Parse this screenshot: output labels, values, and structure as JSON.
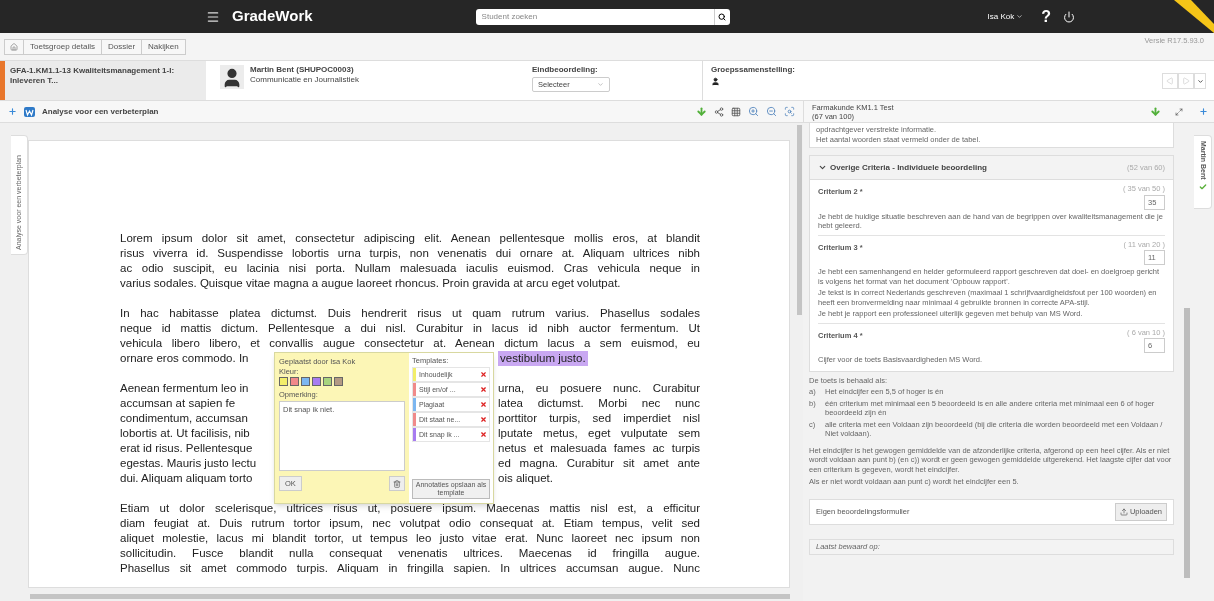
{
  "topbar": {
    "brand": "GradeWork",
    "search": {
      "placeholder": "Student zoeken"
    },
    "user": "Isa Kok",
    "help": "?"
  },
  "breadcrumbs": [
    {
      "label": "Toetsgroep details"
    },
    {
      "label": "Dossier"
    },
    {
      "label": "Nakijken"
    }
  ],
  "version": "Versie R17.5.93.0",
  "info": {
    "assignment": "GFA-1.KM1.1-13 Kwaliteitsmanagement 1-I: Inleveren T...",
    "student_name": "Martin Bent (SHUPOC0003)",
    "student_program": "Communicatie en Journalistiek",
    "final_grade_label": "Eindbeoordeling:",
    "final_grade_select": "Selecteer",
    "group_label": "Groepssamenstelling:"
  },
  "document": {
    "title": "Analyse voor een verbeterplan",
    "side_tab": "Analyse voor een verbeterplan",
    "paragraphs": [
      [
        {
          "kind": "full",
          "text": "Lorem ipsum dolor sit amet, consectetur adipiscing elit. Aenean pellentesque mollis eros, at blandit"
        },
        {
          "kind": "full",
          "text": "risus viverra id. Suspendisse lobortis urna turpis, non venenatis dui ornare at. Aliquam ultrices nibh"
        },
        {
          "kind": "full",
          "text": "ac odio suscipit, eu lacinia nisi porta. Nullam malesuada iaculis euismod. Cras vehicula neque in"
        },
        {
          "kind": "full",
          "text": "varius sodales. Quisque vitae magna a augue laoreet rhoncus. Proin gravida at arcu eget volutpat."
        }
      ],
      [
        {
          "kind": "full",
          "text": "In hac habitasse platea dictumst. Duis hendrerit risus ut quam rutrum varius. Phasellus sodales"
        },
        {
          "kind": "full",
          "text": "neque id mattis dictum. Pellentesque a dui nisl. Curabitur in lacus id nibh auctor fermentum. Ut"
        },
        {
          "kind": "full",
          "text": "vehicula libero libero, et convallis augue consectetur at. Aenean dictum lacus a sem euismod, eu"
        },
        {
          "kind": "split",
          "left": "ornare eros commodo. In",
          "right": "vestibulum justo.",
          "highlighted": true
        }
      ],
      [
        {
          "kind": "split",
          "left": "Aenean fermentum leo in",
          "right": "urna, eu posuere nunc. Curabitur",
          "highlighted": false
        },
        {
          "kind": "split",
          "left": "accumsan at sapien fe",
          "right": "latea dictumst. Morbi nec nunc",
          "highlighted": false
        },
        {
          "kind": "split",
          "left": "condimentum, accumsan",
          "right": "porttitor turpis, sed imperdiet nisl",
          "highlighted": false
        },
        {
          "kind": "split",
          "left": "lobortis at. Ut facilisis, nib",
          "right": "lputate metus, eget vulputate sem",
          "highlighted": false
        },
        {
          "kind": "split",
          "left": "erat id risus. Pellentesque",
          "right": "netus et malesuada fames ac turpis",
          "highlighted": false
        },
        {
          "kind": "split",
          "left": "egestas. Mauris justo lectu",
          "right": "ed magna. Curabitur sit amet ante",
          "highlighted": false
        },
        {
          "kind": "split",
          "left": "dui. Aliquam aliquam torto",
          "right": "ois aliquet.",
          "highlighted": false
        }
      ],
      [
        {
          "kind": "full",
          "text": "Etiam ut dolor scelerisque, ultrices risus ut, posuere ipsum. Maecenas mattis nisl est, a efficitur"
        },
        {
          "kind": "full",
          "text": "diam feugiat at. Duis rutrum tortor ipsum, nec volutpat odio consequat at. Etiam tempus, velit sed"
        },
        {
          "kind": "full",
          "text": "aliquet molestie, lacus mi blandit tortor, ut tempus leo justo vitae erat. Nunc laoreet nec ipsum non"
        },
        {
          "kind": "full",
          "text": "sollicitudin. Fusce blandit nulla consequat venenatis ultrices. Maecenas id fringilla augue."
        },
        {
          "kind": "full",
          "text": "Phasellus sit amet commodo turpis. Aliquam in fringilla sapien. In ultrices accumsan augue. Nunc"
        }
      ]
    ]
  },
  "annotation": {
    "author": "Geplaatst door Isa Kok",
    "color_label": "Kleur:",
    "colors": [
      {
        "color": "#f2ee6a"
      },
      {
        "color": "#f08a8a"
      },
      {
        "color": "#7cb6f0"
      },
      {
        "color": "#a77cf0"
      },
      {
        "color": "#a8d47e"
      },
      {
        "color": "#b39a84"
      }
    ],
    "remark_label": "Opmerking:",
    "remark": "Dit snap ik niet.",
    "ok": "OK",
    "templates_label": "Templates:",
    "templates": [
      {
        "label": "Inhoudelijk",
        "color": "#f2ee6a"
      },
      {
        "label": "Stijl en/of ...",
        "color": "#f08a8a"
      },
      {
        "label": "Plagiaat",
        "color": "#7cb6f0"
      },
      {
        "label": "Dit staat ne...",
        "color": "#f08a8a"
      },
      {
        "label": "Dit snap ik ...",
        "color": "#a77cf0"
      }
    ],
    "save_template": "Annotaties opslaan als template"
  },
  "rubric": {
    "title": "Farmakunde KM1.1 Test",
    "score": "(67 van 100)",
    "side_tab": "Martin Bent",
    "intro_lines": [
      "opdrachtgever verstrekte informatie.",
      "Het aantal woorden staat vermeld onder de tabel."
    ],
    "section": {
      "title": "Overige Criteria - Individuele beoordeling",
      "score": "(52 van 60)",
      "expanded": true,
      "criteria": [
        {
          "name": "Criterium 2 *",
          "range": "( 35 van 50 )",
          "value": "35",
          "descriptions": [
            "Je hebt de huidige situatie beschreven aan de hand van de begrippen over kwaliteitsmanagement die je hebt geleerd."
          ]
        },
        {
          "name": "Criterium 3 *",
          "range": "( 11 van 20 )",
          "value": "11",
          "descriptions": [
            "Je hebt een samenhangend en helder geformuleerd rapport geschreven dat doel- en doelgroep gericht is volgens het format van het document 'Opbouw rapport'.",
            "Je tekst is in correct Nederlands geschreven (maximaal 1 schrijfvaardigheidsfout per 100 woorden) en heeft een bronvermelding naar minimaal 4 gebruikte bronnen in correcte APA-stijl.",
            "Je hebt je rapport een professioneel uiterlijk gegeven met behulp van MS Word."
          ]
        },
        {
          "name": "Criterium 4 *",
          "range": "( 6 van 10 )",
          "value": "6",
          "descriptions": [
            "Cijfer voor de toets Basisvaardigheden MS Word."
          ]
        }
      ]
    },
    "pass_intro": "De toets is behaald als:",
    "conditions": [
      {
        "marker": "a)",
        "text": "Het eindcijfer een 5,5 of hoger is én"
      },
      {
        "marker": "b)",
        "text": "één criterium met minimaal een 5 beoordeeld is en alle andere criteria met minimaal een 6 of hoger beoordeeld zijn én"
      },
      {
        "marker": "c)",
        "text": "alle criteria met een Voldaan zijn beoordeeld (bij die criteria die worden beoordeeld met een Voldaan / Niet voldaan)."
      }
    ],
    "notes": [
      "Het eindcijfer is het gewogen gemiddelde van de afzonderlijke criteria, afgerond op een heel cijfer. Als er niet wordt voldaan aan punt b) (en c)) wordt er geen gewogen gemiddelde uitgerekend. Het laagste cijfer dat voor een criterium is gegeven, wordt het eindcijfer.",
      "Als er niet wordt voldaan aan punt c) wordt het eindcijfer een 5."
    ],
    "own_form": "Eigen beoordelingsformulier",
    "upload": "Uploaden",
    "last_saved": "Laatst bewaard op:"
  }
}
